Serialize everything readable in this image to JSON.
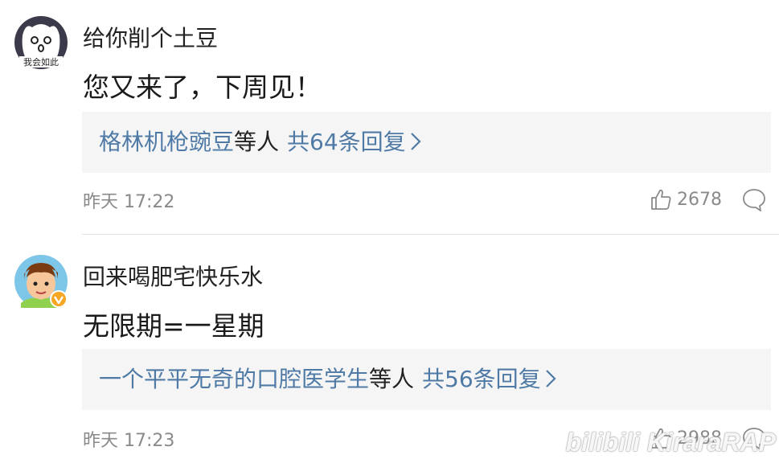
{
  "comments": [
    {
      "username": "给你削个土豆",
      "text": "您又来了，下周见！",
      "avatar_caption": "我会如此",
      "replies": {
        "replier": "格林机枪豌豆",
        "etc": "等人",
        "count_label": "共64条回复"
      },
      "time": "昨天 17:22",
      "likes": "2678",
      "verified": false
    },
    {
      "username": "回来喝肥宅快乐水",
      "text": "无限期=一星期",
      "replies": {
        "replier": "一个平平无奇的口腔医学生",
        "etc": "等人",
        "count_label": "共56条回复"
      },
      "time": "昨天 17:23",
      "likes": "2988",
      "verified": true
    }
  ],
  "watermark": "bilibili KiraraRAP",
  "colors": {
    "link": "#4f7aa6",
    "meta": "#8a8a8a",
    "reply_bg": "#f5f5f5",
    "verified": "#f5a623"
  },
  "icons": [
    "thumbs-up-icon",
    "comment-bubble-icon",
    "chevron-right-icon",
    "verified-badge-icon"
  ]
}
